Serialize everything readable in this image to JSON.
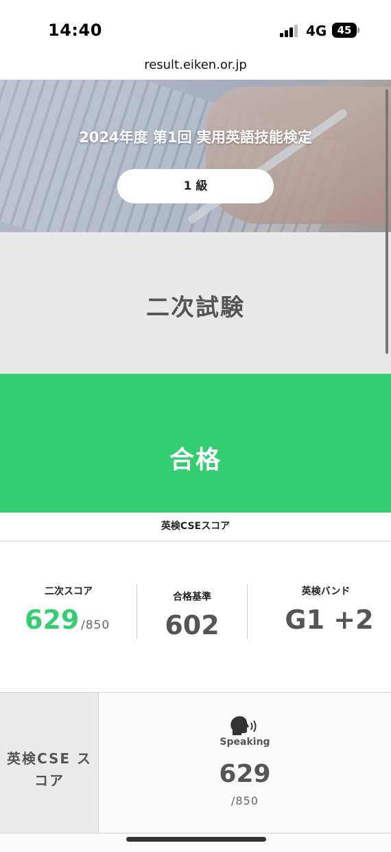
{
  "status_bar": {
    "time": "14:40",
    "network": "4G",
    "battery": "45"
  },
  "browser": {
    "url": "result.eiken.or.jp"
  },
  "hero": {
    "title": "2024年度 第1回 実用英語技能検定",
    "grade": "1 級"
  },
  "exam": {
    "type": "二次試験"
  },
  "result": {
    "label": "合格",
    "color": "#35cd71"
  },
  "cse": {
    "header": "英検CSEスコア",
    "secondary_score": {
      "label": "二次スコア",
      "value": "629",
      "max": "/850"
    },
    "passing_standard": {
      "label": "合格基準",
      "value": "602"
    },
    "band": {
      "label": "英検バンド",
      "value": "G1 +2"
    }
  },
  "skills": {
    "side_label": "英検CSE スコア",
    "speaking": {
      "icon": "speaking-head-icon",
      "label": "Speaking",
      "value": "629",
      "max": "/850"
    }
  }
}
